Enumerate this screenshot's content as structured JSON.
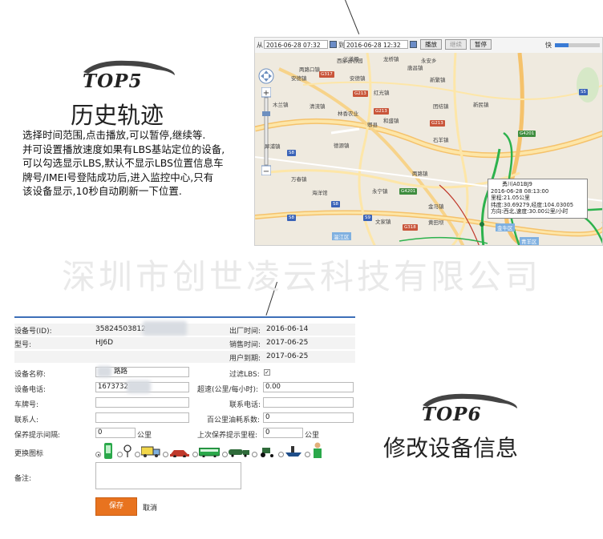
{
  "section1": {
    "logo_text": "TOP5",
    "title": "历史轨迹",
    "description_lines": [
      "选择时间范围,点击播放,可以暂停,继续等.",
      "并可设置播放速度如果有LBS基站定位的设备,",
      "可以勾选显示LBS,默认不显示LBS位置信息车",
      "牌号/IMEI号登陆成功后,进入监控中心,只有",
      "该设备显示,10秒自动刷新一下位置."
    ]
  },
  "section2": {
    "logo_text": "TOP6",
    "title": "修改设备信息"
  },
  "watermark": "深圳市创世凌云科技有限公司",
  "map": {
    "toolbar": {
      "from_label": "从",
      "from_value": "2016-06-28 07:32",
      "to_label": "到",
      "to_value": "2016-06-28 12:32",
      "play_label": "播放",
      "continue_label": "继续",
      "pause_label": "暂停",
      "speed_label": "快",
      "speed_level": 0.3
    },
    "places": [
      "三道堰",
      "龙桥镇",
      "西部云谷园",
      "唐昌镇",
      "永安乡",
      "两路口镇",
      "安德镇",
      "新繁镇",
      "安德镇",
      "清流镇",
      "团结镇",
      "木兰镇",
      "新民镇",
      "红光镇",
      "林香农业",
      "和盛镇",
      "郫县",
      "德源镇",
      "犀浦镇",
      "石羊镇",
      "两路镇",
      "万春镇",
      "永宁镇",
      "海洋馆",
      "文家镇",
      "金马镇",
      "黄田坝",
      "温江区",
      "金牛区",
      "青羊区"
    ],
    "highways": [
      "G317",
      "G213",
      "G213",
      "G213",
      "G4201",
      "G4201",
      "S8",
      "S8",
      "S8",
      "G318",
      "S9",
      "S5"
    ],
    "info_window": {
      "plate": "勇川A01BJ9",
      "time": "2016-06-28 08:13:00",
      "mileage": "里程:21.05公里",
      "coords": "纬度:30.69279,经度:104.03005",
      "status": "方向:西北,速度:30.00公里/小时"
    }
  },
  "form": {
    "rows": {
      "device_id_label": "设备号(ID):",
      "device_id_value": "35824503812",
      "factory_time_label": "出厂时间:",
      "factory_time_value": "2016-06-14",
      "model_label": "型号:",
      "model_value": "HJ6D",
      "sale_time_label": "销售时间:",
      "sale_time_value": "2017-06-25",
      "expire_label": "用户到期:",
      "expire_value": "2017-06-25",
      "device_name_label": "设备名称:",
      "device_name_value": "路路",
      "filter_lbs_label": "过滤LBS:",
      "filter_lbs_checked": "✓",
      "phone_label": "设备电话:",
      "phone_value": "1673732",
      "overspeed_label": "超速(公里/每小时):",
      "overspeed_value": "0.00",
      "plate_label": "车牌号:",
      "contact_phone_label": "联系电话:",
      "contact_label": "联系人:",
      "fuel_label": "百公里油耗系数:",
      "fuel_value": "0",
      "maintenance_interval_label": "保养提示间隔:",
      "maintenance_interval_value": "0",
      "interval_unit": "公里",
      "last_mileage_label": "上次保养提示里程:",
      "last_mileage_value": "0",
      "last_mileage_unit": "公里",
      "icon_label": "更换图标",
      "remark_label": "备注:",
      "save_label": "保存",
      "cancel_label": "取消"
    },
    "vehicle_icons": [
      "phone-icon",
      "pin-icon",
      "truck-icon",
      "car-icon",
      "bus-icon",
      "tanker-icon",
      "tractor-icon",
      "ship-icon",
      "person-icon"
    ]
  }
}
